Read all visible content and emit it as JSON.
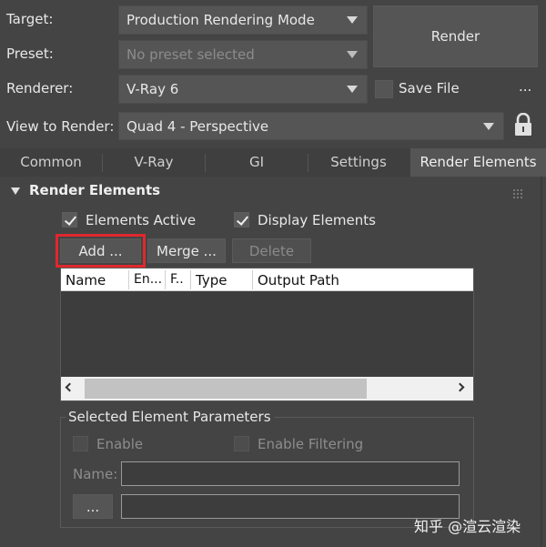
{
  "render_setup": {
    "target_label": "Target:",
    "target_value": "Production Rendering Mode",
    "preset_label": "Preset:",
    "preset_value": "No preset selected",
    "renderer_label": "Renderer:",
    "renderer_value": "V-Ray 6",
    "view_label": "View to Render:",
    "view_value": "Quad 4 - Perspective",
    "render_button": "Render",
    "save_file_label": "Save File",
    "more_button": "..."
  },
  "tabs": [
    "Common",
    "V-Ray",
    "GI",
    "Settings",
    "Render Elements"
  ],
  "active_tab": "Render Elements",
  "render_elements": {
    "rollout_title": "Render Elements",
    "elements_active_label": "Elements Active",
    "elements_active_checked": true,
    "display_elements_label": "Display Elements",
    "display_elements_checked": true,
    "add_button": "Add ...",
    "merge_button": "Merge ...",
    "delete_button": "Delete",
    "columns": [
      "Name",
      "En...",
      "F..",
      "Type",
      "Output Path"
    ],
    "rows": []
  },
  "selected_params": {
    "group_title": "Selected Element Parameters",
    "enable_label": "Enable",
    "enable_filtering_label": "Enable Filtering",
    "name_label": "Name:",
    "name_value": "",
    "browse_button": "...",
    "path_value": ""
  },
  "watermark": "知乎 @渲云渲染",
  "colors": {
    "highlight_border": "#e0282e",
    "panel_bg": "#444444",
    "control_bg": "#555555"
  }
}
